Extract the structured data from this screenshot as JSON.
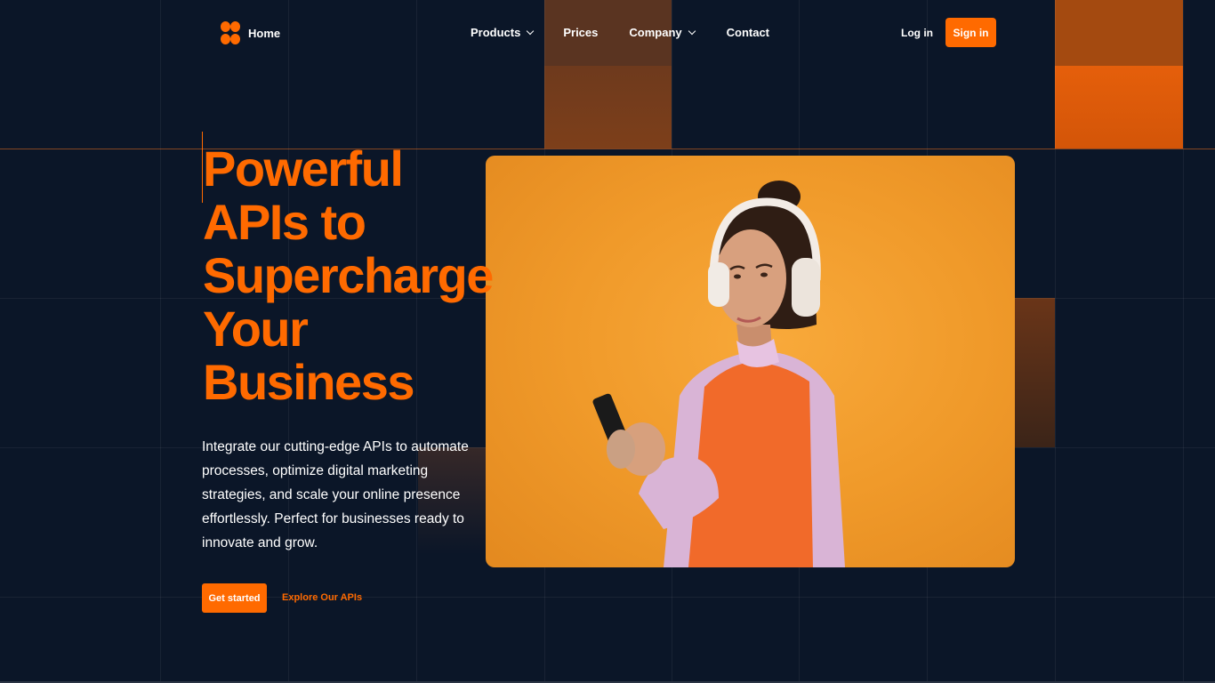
{
  "brand": {
    "name": "Home",
    "accent": "#ff6a00",
    "background": "#0b1628"
  },
  "nav": {
    "items": [
      {
        "label": "Products",
        "has_dropdown": true
      },
      {
        "label": "Prices",
        "has_dropdown": false
      },
      {
        "label": "Company",
        "has_dropdown": true
      },
      {
        "label": "Contact",
        "has_dropdown": false
      }
    ],
    "login_label": "Log in",
    "signin_label": "Sign in"
  },
  "hero": {
    "headline_lines": [
      "Powerful",
      "APIs to",
      "Supercharge",
      "Your",
      "Business"
    ],
    "description": "Integrate our cutting-edge APIs to automate processes, optimize digital marketing strategies, and scale your online presence effortlessly. Perfect for businesses ready to innovate and grow.",
    "primary_cta": "Get started",
    "secondary_cta": "Explore Our APIs",
    "image": {
      "subject": "woman-with-headphones-using-phone"
    }
  }
}
